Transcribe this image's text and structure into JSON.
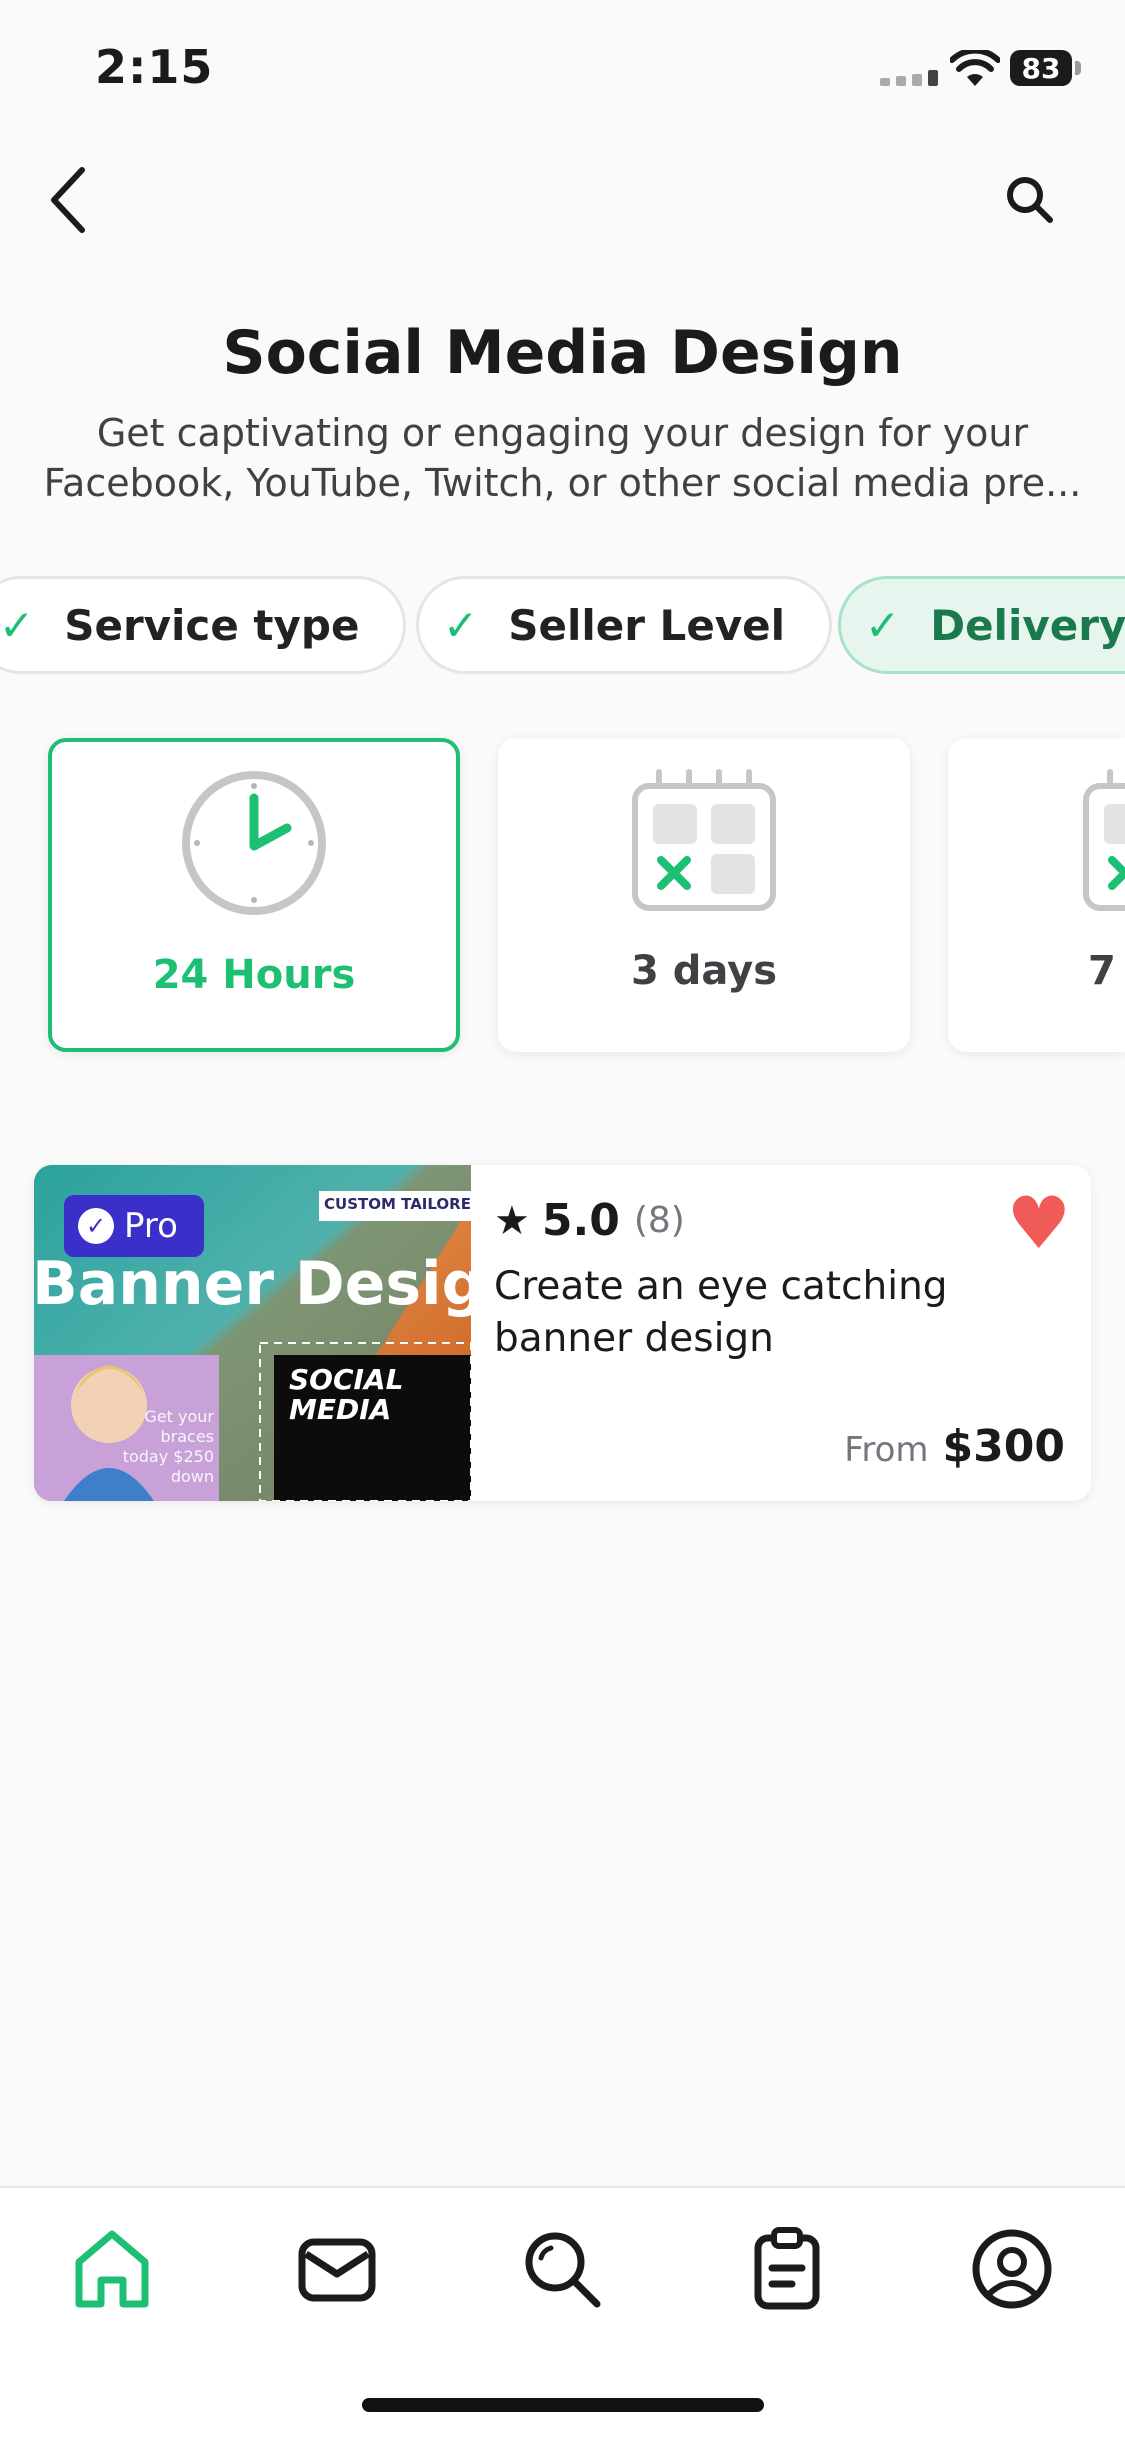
{
  "status_bar": {
    "time": "2:15",
    "battery": "83"
  },
  "header": {
    "back_icon": "chevron-left-icon",
    "search_icon": "search-icon",
    "title": "Social Media Design",
    "subtitle": "Get captivating or engaging your design for your Facebook, YouTube, Twitch, or other social media pre..."
  },
  "filters": [
    {
      "label": "Service type",
      "active": false
    },
    {
      "label": "Seller Level",
      "active": false
    },
    {
      "label": "Delivery",
      "active": true
    }
  ],
  "delivery_options": [
    {
      "label": "24 Hours",
      "icon": "clock-icon",
      "selected": true
    },
    {
      "label": "3 days",
      "icon": "calendar-icon",
      "selected": false
    },
    {
      "label": "7",
      "icon": "calendar-icon",
      "selected": false
    }
  ],
  "gig": {
    "badge": "Pro",
    "rating": "5.0",
    "review_count": "(8)",
    "title": "Create an eye catching banner design",
    "price_prefix": "From",
    "price": "$300",
    "favorited": true,
    "thumbnail_text": {
      "headline": "Banner Design",
      "tag": "CUSTOM TAILORED",
      "poster": "SOCIAL MEDIA",
      "ad_text": "Get your braces today $250 down"
    }
  },
  "bottom_nav": [
    {
      "name": "home",
      "icon": "home-icon",
      "active": true
    },
    {
      "name": "inbox",
      "icon": "mail-icon",
      "active": false
    },
    {
      "name": "search",
      "icon": "search-icon",
      "active": false
    },
    {
      "name": "orders",
      "icon": "clipboard-icon",
      "active": false
    },
    {
      "name": "profile",
      "icon": "profile-icon",
      "active": false
    }
  ],
  "colors": {
    "accent": "#1dbf73",
    "heart": "#f05a57",
    "pro": "#3b2fc9"
  }
}
